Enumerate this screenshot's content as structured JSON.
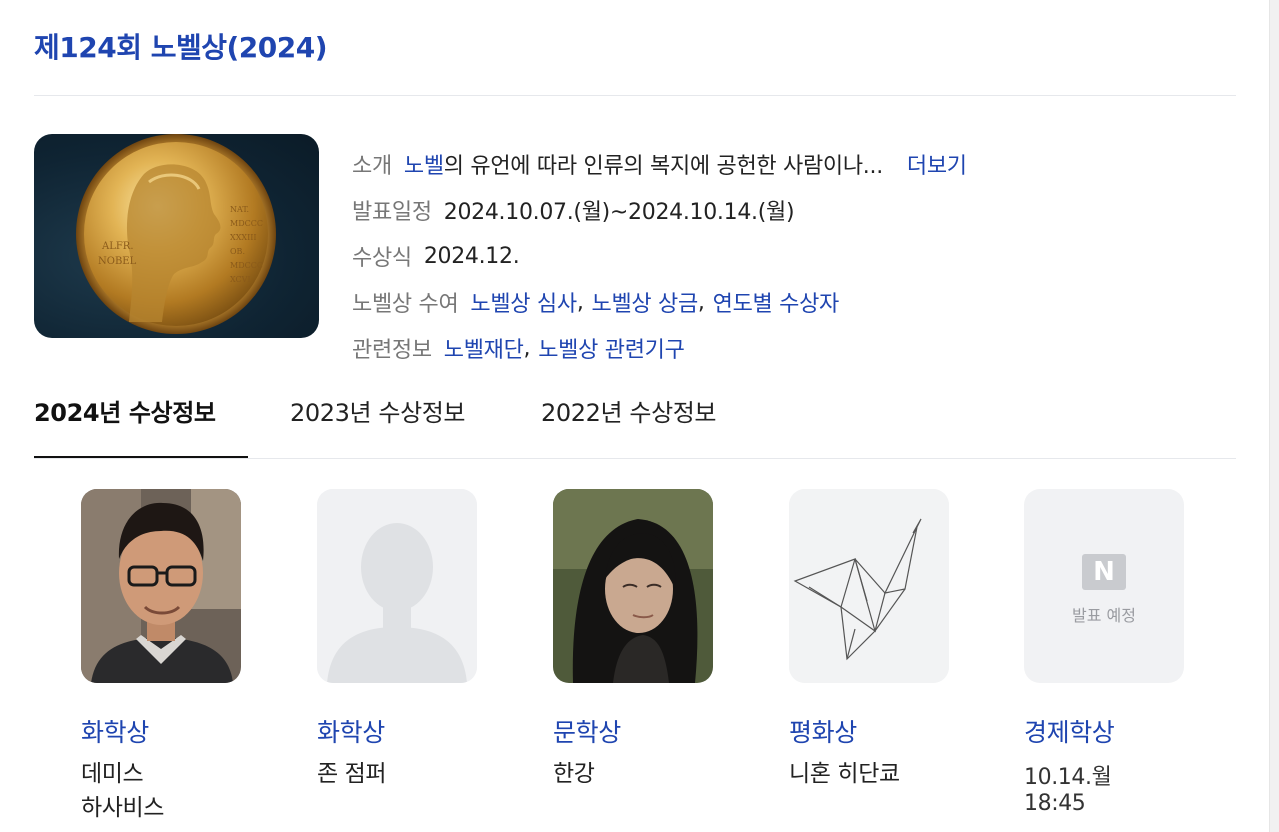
{
  "title": "제124회 노벨상(2024)",
  "info": {
    "intro": {
      "label": "소개",
      "link": "노벨",
      "text": "의 유언에 따라 인류의 복지에 공헌한 사람이나...",
      "more": "더보기"
    },
    "schedule": {
      "label": "발표일정",
      "value": "2024.10.07.(월)~2024.10.14.(월)"
    },
    "ceremony": {
      "label": "수상식",
      "value": "2024.12."
    },
    "award": {
      "label": "노벨상 수여",
      "links": [
        "노벨상 심사",
        "노벨상 상금",
        "연도별 수상자"
      ],
      "sep": ","
    },
    "related": {
      "label": "관련정보",
      "links": [
        "노벨재단",
        "노벨상 관련기구"
      ],
      "sep": ","
    }
  },
  "tabs": [
    "2024년 수상정보",
    "2023년 수상정보",
    "2022년 수상정보"
  ],
  "active_tab": 0,
  "medal_icon": "nobel-medal-image",
  "winners": [
    {
      "category": "화학상",
      "name_lines": [
        "데미스",
        "하사비스"
      ],
      "photo": "person-photo"
    },
    {
      "category": "화학상",
      "name_lines": [
        "존 점퍼"
      ],
      "photo": "person-placeholder-icon"
    },
    {
      "category": "문학상",
      "name_lines": [
        "한강"
      ],
      "photo": "person-photo"
    },
    {
      "category": "평화상",
      "name_lines": [
        "니혼 히단쿄"
      ],
      "photo": "paper-crane-icon"
    },
    {
      "category": "경제학상",
      "time": "10.14.월 18:45",
      "pending_logo": "N",
      "pending_text": "발표 예정",
      "photo": "naver-logo-icon"
    }
  ],
  "colors": {
    "link": "#1f45b0",
    "label": "#777777",
    "text": "#222222",
    "divider": "#e6e8ec"
  }
}
